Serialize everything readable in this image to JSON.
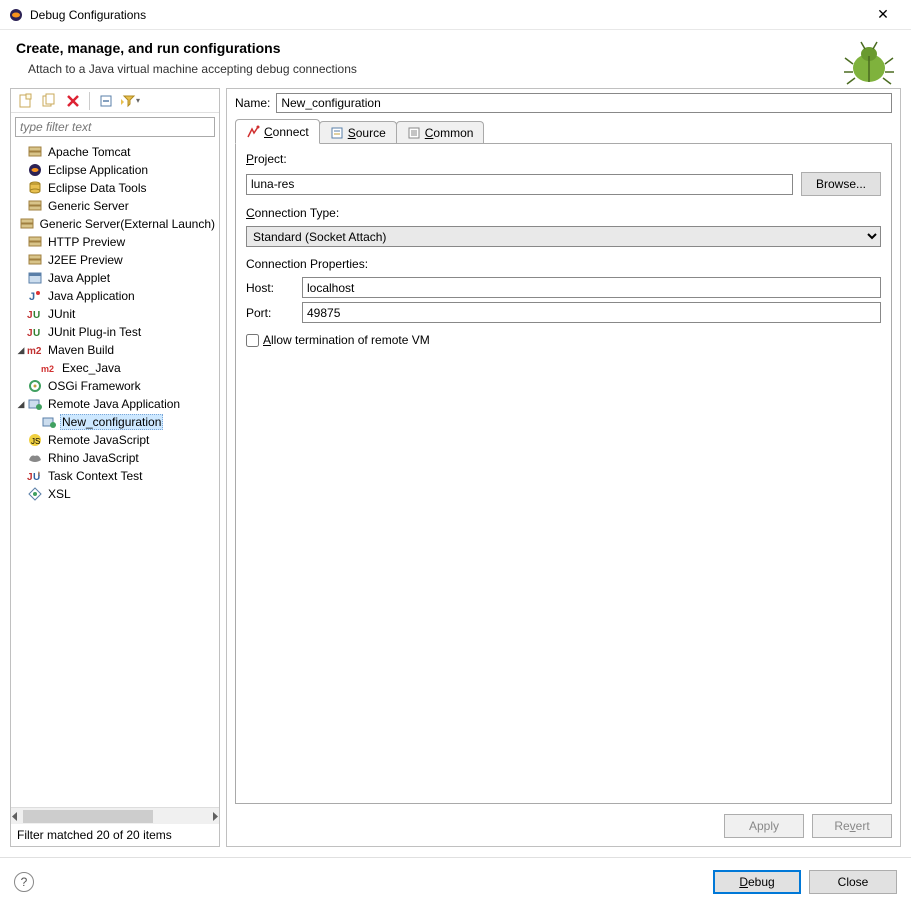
{
  "window": {
    "title": "Debug Configurations"
  },
  "header": {
    "title": "Create, manage, and run configurations",
    "subtitle": "Attach to a Java virtual machine accepting debug connections"
  },
  "filter": {
    "placeholder": "type filter text"
  },
  "tree": {
    "items": [
      {
        "label": "Apache Tomcat",
        "icon": "server"
      },
      {
        "label": "Eclipse Application",
        "icon": "eclipse"
      },
      {
        "label": "Eclipse Data Tools",
        "icon": "db"
      },
      {
        "label": "Generic Server",
        "icon": "server"
      },
      {
        "label": "Generic Server(External Launch)",
        "icon": "server"
      },
      {
        "label": "HTTP Preview",
        "icon": "server"
      },
      {
        "label": "J2EE Preview",
        "icon": "server"
      },
      {
        "label": "Java Applet",
        "icon": "applet"
      },
      {
        "label": "Java Application",
        "icon": "java"
      },
      {
        "label": "JUnit",
        "icon": "junit"
      },
      {
        "label": "JUnit Plug-in Test",
        "icon": "junit"
      },
      {
        "label": "Maven Build",
        "icon": "maven",
        "expanded": true
      },
      {
        "label": "Exec_Java",
        "icon": "maven-red",
        "indent": 1
      },
      {
        "label": "OSGi Framework",
        "icon": "osgi"
      },
      {
        "label": "Remote Java Application",
        "icon": "remote",
        "expanded": true
      },
      {
        "label": "New_configuration",
        "icon": "remote",
        "indent": 1,
        "selected": true
      },
      {
        "label": "Remote JavaScript",
        "icon": "js"
      },
      {
        "label": "Rhino JavaScript",
        "icon": "rhino"
      },
      {
        "label": "Task Context Test",
        "icon": "task"
      },
      {
        "label": "XSL",
        "icon": "xsl"
      }
    ],
    "status": "Filter matched 20 of 20 items"
  },
  "form": {
    "name_label": "Name:",
    "name_value": "New_configuration",
    "tabs": [
      {
        "label": "Connect",
        "active": true
      },
      {
        "label": "Source"
      },
      {
        "label": "Common"
      }
    ],
    "project_label": "Project:",
    "project_value": "luna-res",
    "browse_label": "Browse...",
    "conn_type_label": "Connection Type:",
    "conn_type_value": "Standard (Socket Attach)",
    "conn_props_label": "Connection Properties:",
    "host_label": "Host:",
    "host_value": "localhost",
    "port_label": "Port:",
    "port_value": "49875",
    "allow_term_label": "Allow termination of remote VM",
    "apply_label": "Apply",
    "revert_label": "Revert"
  },
  "footer": {
    "debug_label": "Debug",
    "close_label": "Close"
  }
}
